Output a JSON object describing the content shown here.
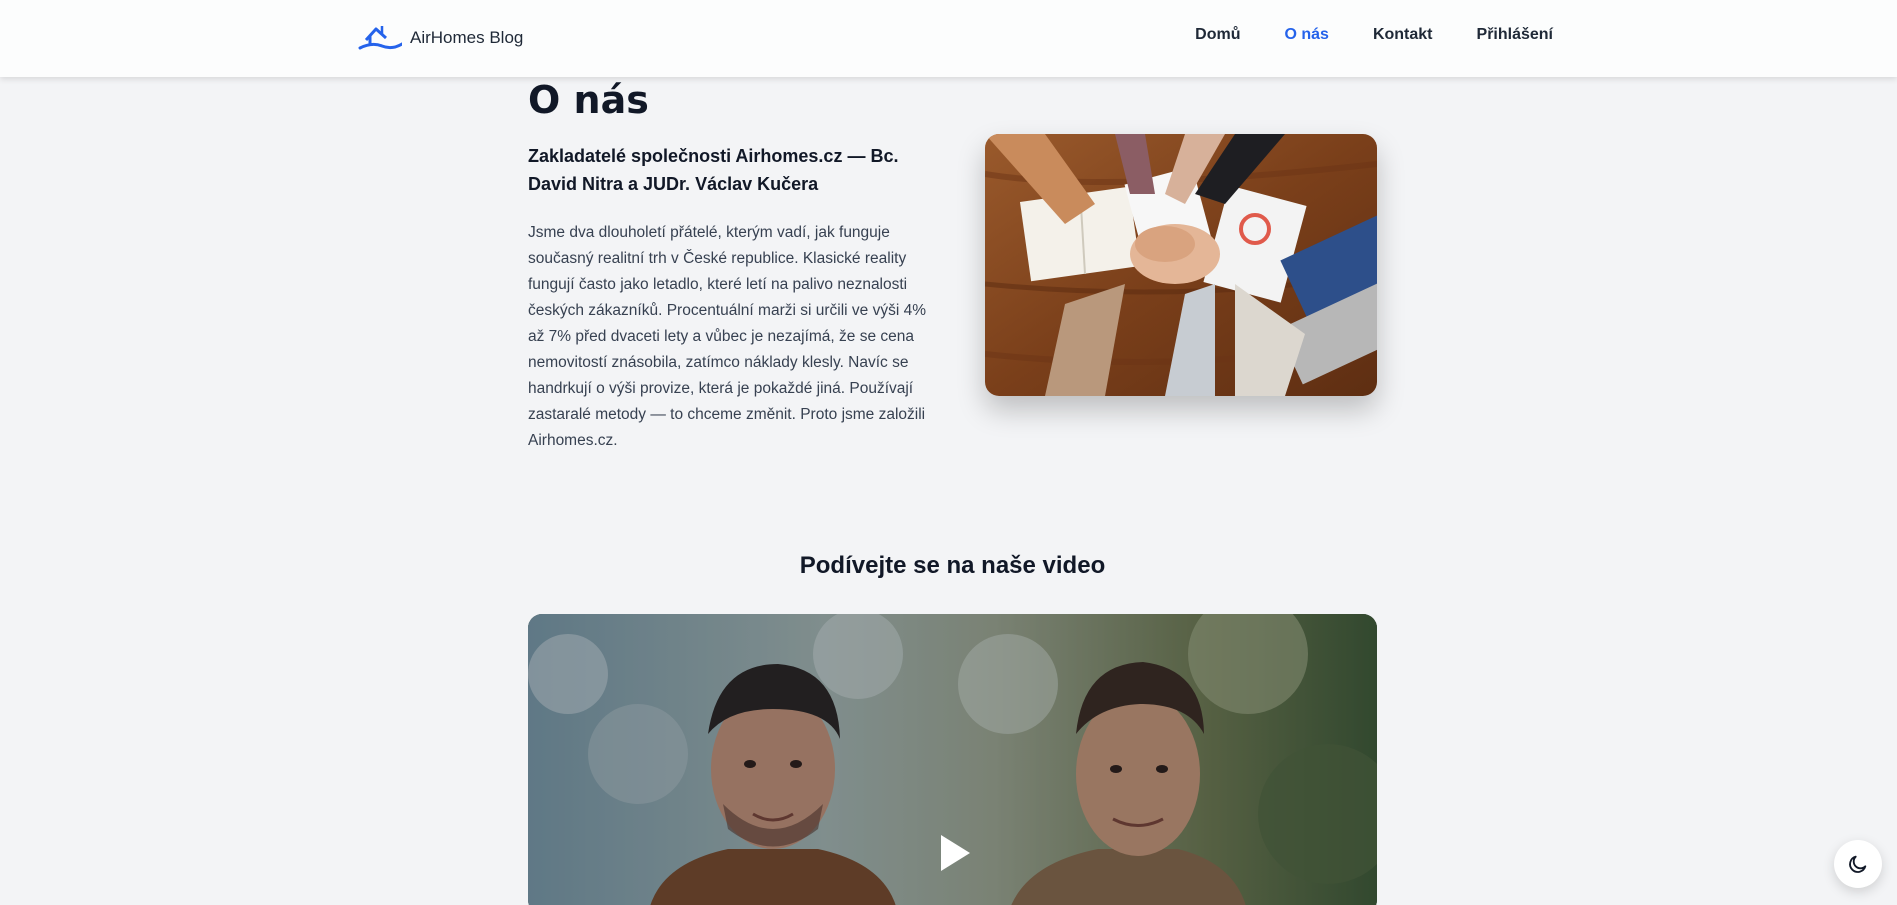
{
  "header": {
    "brand_name": "AirHomes Blog",
    "nav": {
      "home": "Domů",
      "about": "O nás",
      "contact": "Kontakt",
      "login": "Přihlášení"
    },
    "active_nav": "about"
  },
  "about": {
    "title": "O nás",
    "subtitle": "Zakladatelé společnosti Airhomes.cz — Bc. David Nitra a JUDr. Václav Kučera",
    "body": "Jsme dva dlouholetí přátelé, kterým vadí, jak funguje současný realitní trh v České republice. Klasické reality fungují často jako letadlo, které letí na palivo neznalosti českých zákazníků. Procentuální marži si určili ve výši 4% až 7% před dvaceti lety a vůbec je nezajímá, že se cena nemovitostí znásobila, zatímco náklady klesly. Navíc se handrkují o výši provize, která je pokaždé jiná. Používají zastaralé metody — to chceme změnit. Proto jsme založili Airhomes.cz."
  },
  "video_section": {
    "title": "Podívejte se na naše video"
  },
  "icons": {
    "logo": "house-logo-icon",
    "play": "play-icon",
    "theme": "moon-icon"
  },
  "colors": {
    "accent": "#2563eb",
    "background": "#f3f4f6",
    "header_bg": "#fcfdfd"
  }
}
